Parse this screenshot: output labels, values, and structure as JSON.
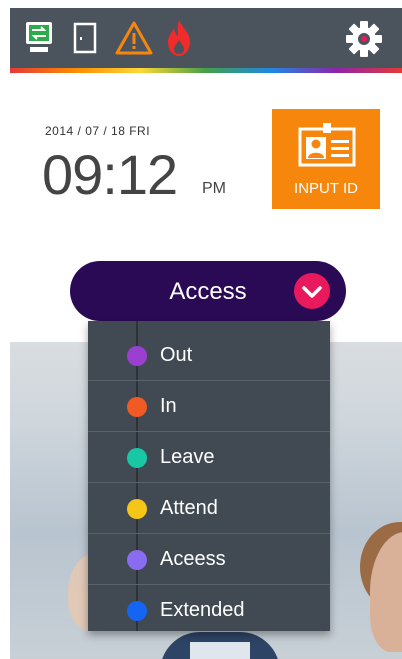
{
  "colors": {
    "topbar_bg": "#4b535d",
    "accent_orange": "#f7860d",
    "selector_bg": "#2b0a55",
    "selector_chevron_bg": "#e9195e",
    "menu_bg": "#414a53"
  },
  "status_icons": [
    "monitor-network-icon",
    "door-icon",
    "warning-icon",
    "fire-icon"
  ],
  "clock": {
    "date": "2014 / 07 / 18 FRI",
    "time": "09:12",
    "ampm": "PM"
  },
  "input_id": {
    "label": "INPUT ID",
    "icon": "id-card-icon"
  },
  "selector": {
    "label": "Access",
    "icon": "chevron-down-icon"
  },
  "menu": {
    "items": [
      {
        "label": "Out",
        "color": "#9b3fd1"
      },
      {
        "label": "In",
        "color": "#f15a24"
      },
      {
        "label": "Leave",
        "color": "#18c8a5"
      },
      {
        "label": "Attend",
        "color": "#f5c518"
      },
      {
        "label": "Aceess",
        "color": "#8a6cf0"
      },
      {
        "label": "Extended",
        "color": "#1565f5"
      }
    ]
  }
}
